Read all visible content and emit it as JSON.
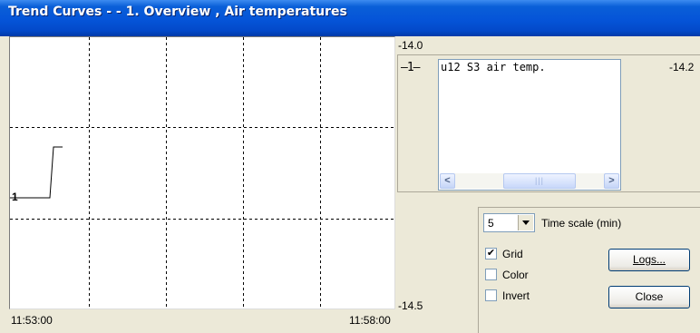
{
  "window": {
    "title": "Trend Curves -  - 1. Overview , Air temperatures"
  },
  "graph": {
    "x_start": "11:53:00",
    "x_end": "11:58:00",
    "y_top": "-14.0",
    "y_bottom": "-14.5",
    "series_marker": "1"
  },
  "legend": {
    "line_marker": "—1—",
    "items": [
      "u12 S3 air temp."
    ],
    "current_value": "-14.2"
  },
  "controls": {
    "time_scale_value": "5",
    "time_scale_label": "Time scale (min)",
    "grid_label": "Grid",
    "grid_checked": "✔",
    "color_label": "Color",
    "invert_label": "Invert",
    "logs_button": "Logs...",
    "close_button": "Close"
  },
  "colors": {
    "title_bar": "#0554d8",
    "curve": "#000000",
    "window_bg": "#ece9d8"
  }
}
